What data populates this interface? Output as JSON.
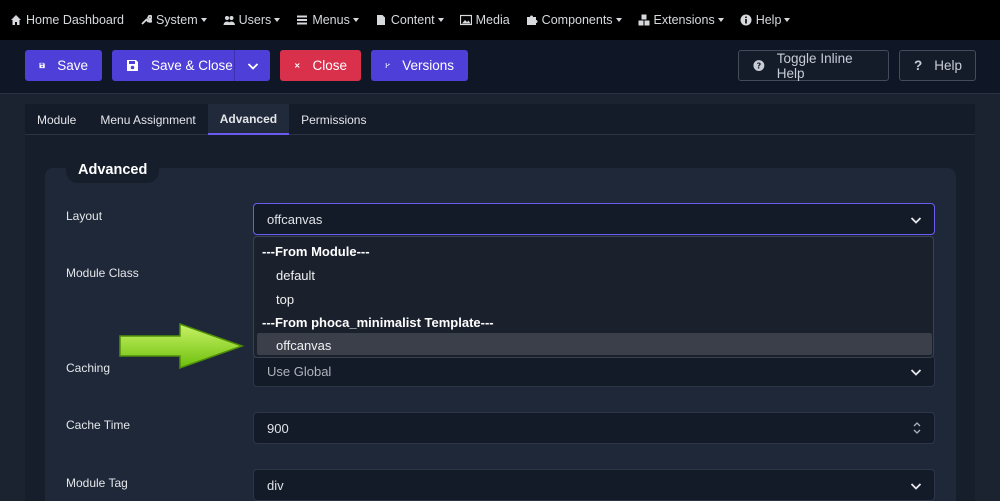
{
  "menubar": {
    "items": [
      {
        "label": "Home Dashboard",
        "icon": "home-icon",
        "caret": false
      },
      {
        "label": "System",
        "icon": "wrench-icon",
        "caret": true
      },
      {
        "label": "Users",
        "icon": "users-icon",
        "caret": true
      },
      {
        "label": "Menus",
        "icon": "list-icon",
        "caret": true
      },
      {
        "label": "Content",
        "icon": "file-icon",
        "caret": true
      },
      {
        "label": "Media",
        "icon": "image-icon",
        "caret": false
      },
      {
        "label": "Components",
        "icon": "puzzle-icon",
        "caret": true
      },
      {
        "label": "Extensions",
        "icon": "cubes-icon",
        "caret": true
      },
      {
        "label": "Help",
        "icon": "info-icon",
        "caret": true
      }
    ]
  },
  "toolbar": {
    "save_label": "Save",
    "save_close_label": "Save & Close",
    "close_label": "Close",
    "versions_label": "Versions",
    "toggle_help_label": "Toggle Inline Help",
    "help_label": "Help"
  },
  "tabs": [
    {
      "label": "Module",
      "active": false
    },
    {
      "label": "Menu Assignment",
      "active": false
    },
    {
      "label": "Advanced",
      "active": true
    },
    {
      "label": "Permissions",
      "active": false
    }
  ],
  "form": {
    "legend": "Advanced",
    "layout_label": "Layout",
    "layout_value": "offcanvas",
    "module_class_label": "Module Class",
    "caching_label": "Caching",
    "caching_value": "Use Global",
    "cache_time_label": "Cache Time",
    "cache_time_value": "900",
    "module_tag_label": "Module Tag",
    "module_tag_value": "div"
  },
  "layout_dropdown": {
    "group1": "---From Module---",
    "option1": "default",
    "option2": "top",
    "group2": "---From phoca_minimalist Template---",
    "option3": "offcanvas",
    "selected": "offcanvas"
  },
  "colors": {
    "accent": "#4f3fd9",
    "danger": "#d9314b",
    "annotation_arrow": "#8bd61c"
  }
}
